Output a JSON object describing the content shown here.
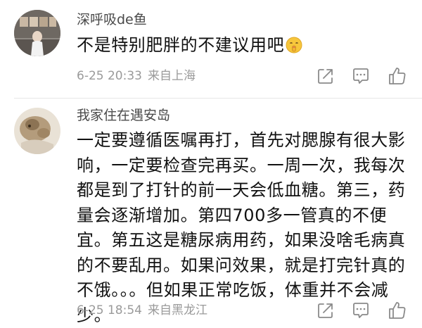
{
  "comments": [
    {
      "username": "深呼吸de鱼",
      "content": "不是特别肥胖的不建议用吧",
      "emoji": "shushing-face-emoji",
      "time": "6-25 20:33",
      "location": "来自上海"
    },
    {
      "username": "我家住在遇安岛",
      "content": "一定要遵循医嘱再打，首先对腮腺有很大影响，一定要检查完再买。一周一次，我每次都是到了打针的前一天会低血糖。第三，药量会逐渐增加。第四700多一管真的不便宜。第五这是糖尿病用药，如果没啥毛病真的不要乱用。如果问效果，就是打完针真的不饿。。。但如果正常吃饭，体重并不会减少。",
      "time": "6-25 18:54",
      "location": "来自黑龙江"
    }
  ],
  "icons": {
    "share": "share-icon",
    "comment": "comment-icon",
    "like": "thumbs-up-icon"
  },
  "colors": {
    "username": "#4a4a4a",
    "content": "#111111",
    "meta": "#9a9a9a",
    "icon": "#8a8a8a"
  }
}
